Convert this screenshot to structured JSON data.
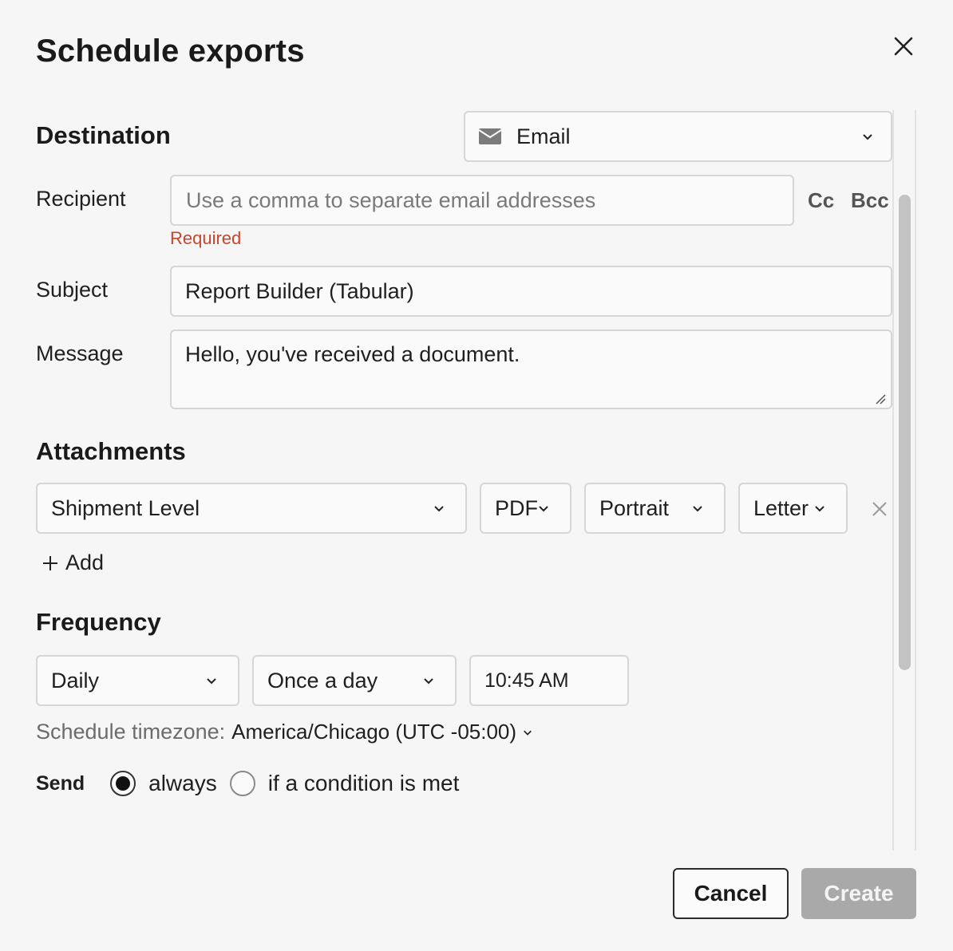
{
  "dialog": {
    "title": "Schedule exports",
    "close_icon": "close-icon"
  },
  "destination": {
    "heading": "Destination",
    "selected": "Email",
    "icon": "envelope-icon"
  },
  "recipient": {
    "label": "Recipient",
    "placeholder": "Use a comma to separate email addresses",
    "value": "",
    "error": "Required",
    "cc_label": "Cc",
    "bcc_label": "Bcc"
  },
  "subject": {
    "label": "Subject",
    "value": "Report Builder (Tabular)"
  },
  "message": {
    "label": "Message",
    "value": "Hello, you've received a document."
  },
  "attachments": {
    "heading": "Attachments",
    "row": {
      "level": "Shipment Level",
      "format": "PDF",
      "orientation": "Portrait",
      "paper": "Letter"
    },
    "add_label": "Add"
  },
  "frequency": {
    "heading": "Frequency",
    "period": "Daily",
    "times": "Once a day",
    "time": "10:45 AM",
    "timezone_label": "Schedule timezone:",
    "timezone_value": "America/Chicago (UTC -05:00)"
  },
  "send": {
    "label": "Send",
    "options": [
      "always",
      "if a condition is met"
    ],
    "selected": "always"
  },
  "footer": {
    "cancel_label": "Cancel",
    "create_label": "Create"
  },
  "colors": {
    "error": "#c8452b",
    "disabled_button": "#a9a9a9",
    "background": "#f6f6f6"
  }
}
